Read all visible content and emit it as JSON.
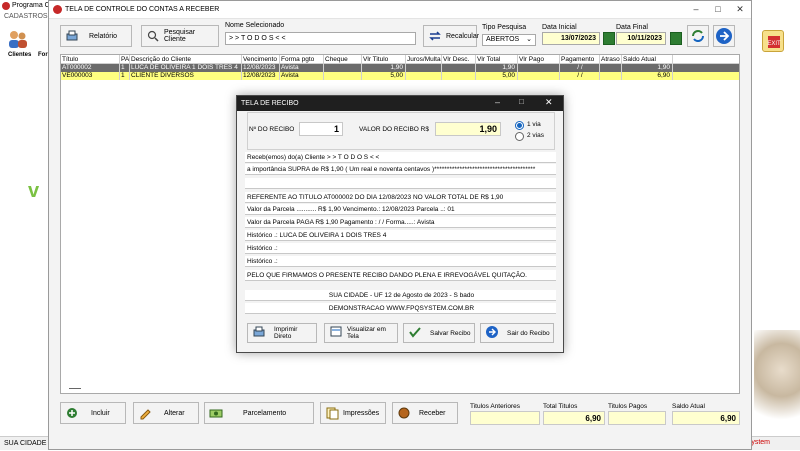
{
  "background_app": {
    "title": "Programa C",
    "menu": "CADASTROS",
    "tool_clientes": "Clientes",
    "tool_fornecedores": "Forn",
    "status_left": "SUA CIDADE -",
    "status_right": "System"
  },
  "window": {
    "title": "TELA DE CONTROLE DO CONTAS A RECEBER",
    "relatorio": "Relatório",
    "pesquisar_cliente": "Pesquisar Cliente",
    "nome_label": "Nome Selecionado",
    "nome_value": "> > T O D O S < <",
    "recalcular": "Recalcular",
    "tipo_label": "Tipo  Pesquisa",
    "tipo_value": "ABERTOS",
    "data_inicial_label": "Data Inicial",
    "data_inicial": "13/07/2023",
    "data_final_label": "Data Final",
    "data_final": "10/11/2023"
  },
  "grid": {
    "columns": [
      "Título",
      "PA",
      "Descrição do Cliente",
      "Vencimento",
      "Forma pgto",
      "Cheque",
      "Vlr Titulo",
      "Juros/Multa",
      "Vlr Desc.",
      "Vlr Total",
      "Vlr Pago",
      "Pagamento",
      "Atraso",
      "Saldo Atual"
    ],
    "rows": [
      [
        "AT000002",
        "1",
        "LUCA DE OLIVEIRA 1 DOIS TRES 4",
        "12/08/2023",
        "Avista",
        "",
        "1,90",
        "",
        "",
        "1,90",
        "",
        "/ /",
        "",
        "1,90"
      ],
      [
        "VE000003",
        "1",
        "CLIENTE DIVERSOS",
        "12/08/2023",
        "Avista",
        "",
        "5,00",
        "",
        "",
        "5,00",
        "",
        "/ /",
        "",
        "6,90"
      ]
    ]
  },
  "footer_buttons": {
    "incluir": "Incluir",
    "alterar": "Alterar",
    "parcelamento": "Parcelamento",
    "impressoes": "Impressões",
    "receber": "Receber"
  },
  "totals": {
    "titulos_anteriores_label": "Titulos Anteriores",
    "titulos_anteriores": "",
    "total_titulos_label": "Total Titulos",
    "total_titulos": "6,90",
    "titulos_pagos_label": "Titulos Pagos",
    "titulos_pagos": "",
    "saldo_atual_label": "Saldo Atual",
    "saldo_atual": "6,90"
  },
  "dialog": {
    "title": "TELA DE RECIBO",
    "nro_label": "Nº DO RECIBO",
    "nro_value": "1",
    "valor_label": "VALOR DO RECIBO R$",
    "valor_value": "1,90",
    "via1": "1 via",
    "via2": "2 vias",
    "lines": [
      "Receb(emos) do(a) Cliente > > T O D O S < <",
      "a importância SUPRA de R$         1,90 ( Um real e noventa  centavos )****************************************",
      "",
      "REFERENTE AO TITULO   AT000002    DO DIA 12/08/2023   NO VALOR TOTAL DE R$           1,90",
      "Valor da Parcela ........... R$          1,90   Vencimento.: 12/08/2023    Parcela ..:  01",
      "Valor da Parcela PAGA R$         1,90   Pagamento :    /  /          Forma.....: Avista",
      "Histórico .: LUCA DE OLIVEIRA 1 DOIS TRES 4",
      "Histórico .:",
      "Histórico .:",
      "PELO QUE FIRMAMOS O PRESENTE RECIBO DANDO PLENA E IRREVOGÁVEL QUITAÇÃO."
    ],
    "city_line": "SUA CIDADE - UF 12 de Agosto de 2023 - S bado",
    "demo_line": "DEMONSTRACAO WWW.FPQSYSTEM.COM.BR",
    "imprimir": "Imprimir Direto",
    "visualizar": "Visualizar em Tela",
    "salvar": "Salvar Recibo",
    "sair": "Sair do Recibo"
  }
}
